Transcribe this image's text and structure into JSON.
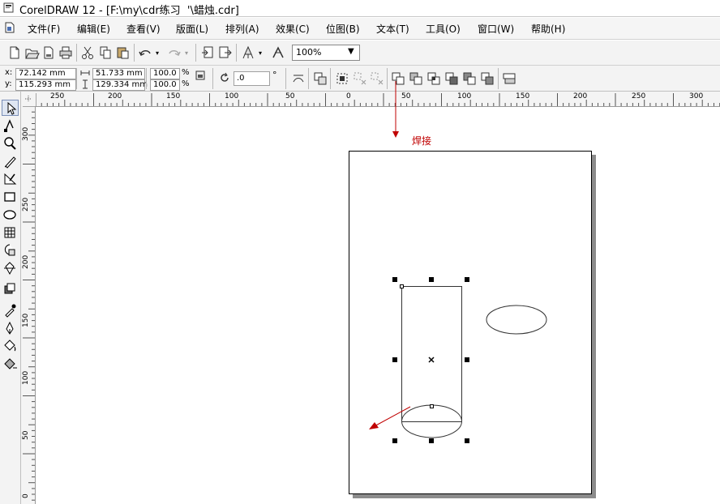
{
  "window": {
    "title": "CorelDRAW 12 - [F:\\my\\cdr练习  '\\蜡烛.cdr]"
  },
  "menu": [
    {
      "label": "文件(F)"
    },
    {
      "label": "编辑(E)"
    },
    {
      "label": "查看(V)"
    },
    {
      "label": "版面(L)"
    },
    {
      "label": "排列(A)"
    },
    {
      "label": "效果(C)"
    },
    {
      "label": "位图(B)"
    },
    {
      "label": "文本(T)"
    },
    {
      "label": "工具(O)"
    },
    {
      "label": "窗口(W)"
    },
    {
      "label": "帮助(H)"
    }
  ],
  "toolbar": {
    "zoom": "100%"
  },
  "property_bar": {
    "x_label": "x:",
    "x_value": "72.142 mm",
    "y_label": "y:",
    "y_value": "115.293 mm",
    "width_value": "51.733 mm",
    "height_value": "129.334 mm",
    "scale_x": "100.0",
    "scale_y": "100.0",
    "percent": "%",
    "rotation": ".0",
    "degree": "°"
  },
  "rulers": {
    "horizontal": [
      "250",
      "200",
      "150",
      "100",
      "50",
      "0",
      "50",
      "100",
      "150",
      "200",
      "250",
      "300"
    ],
    "vertical": [
      "300",
      "250",
      "200",
      "150",
      "100",
      "50",
      "0"
    ]
  },
  "annotations": {
    "weld_label": "焊接"
  },
  "colors": {
    "arrow": "#c00000",
    "menu_bg": "#f5f5f5",
    "toolbar_bg": "#f3f3f3",
    "ruler_bg": "#f4f4f4",
    "page_shadow": "#8c8c8c"
  },
  "icons": {
    "toolbox": [
      "pick-tool-icon",
      "shape-tool-icon",
      "zoom-tool-icon",
      "freehand-tool-icon",
      "smart-drawing-tool-icon",
      "rectangle-tool-icon",
      "ellipse-tool-icon",
      "graph-paper-tool-icon",
      "basic-shapes-tool-icon",
      "text-tool-icon",
      "interactive-blend-tool-icon",
      "eyedropper-tool-icon",
      "outline-pen-tool-icon",
      "fill-tool-icon",
      "interactive-fill-tool-icon"
    ]
  }
}
